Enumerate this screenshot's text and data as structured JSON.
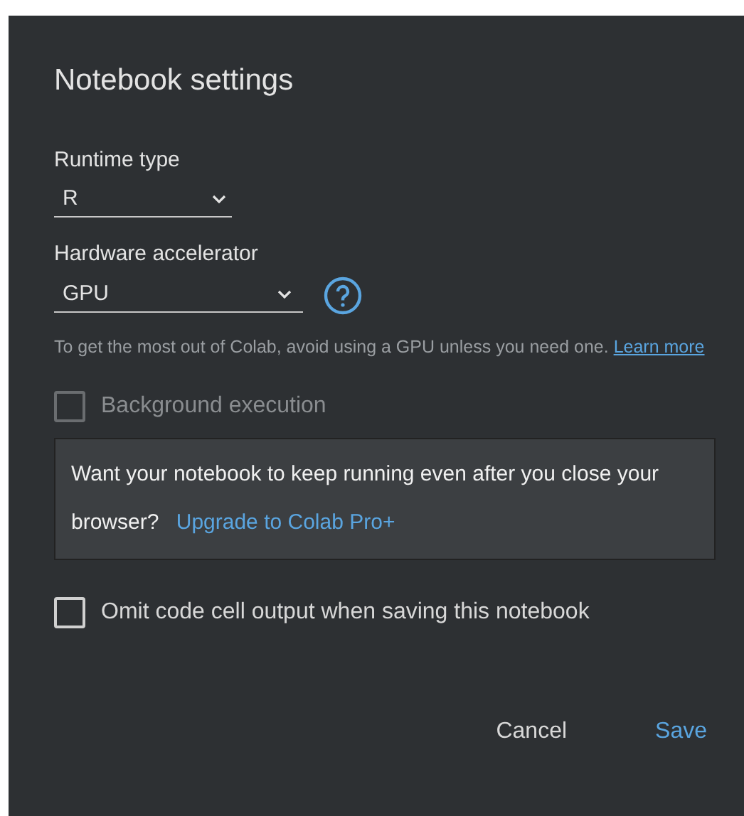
{
  "dialog": {
    "title": "Notebook settings",
    "runtime_type": {
      "label": "Runtime type",
      "value": "R"
    },
    "hardware_accelerator": {
      "label": "Hardware accelerator",
      "value": "GPU"
    },
    "hint": {
      "text": "To get the most out of Colab, avoid using a GPU unless you need one.",
      "link": "Learn more"
    },
    "background_execution": {
      "label": "Background execution",
      "checked": false,
      "disabled": true
    },
    "upsell": {
      "text": "Want your notebook to keep running even after you close your browser?",
      "link": "Upgrade to Colab Pro+"
    },
    "omit_output": {
      "label": "Omit code cell output when saving this notebook",
      "checked": false,
      "disabled": false
    },
    "buttons": [
      {
        "label": "Cancel",
        "kind": "secondary"
      },
      {
        "label": "Save",
        "kind": "primary"
      }
    ]
  }
}
